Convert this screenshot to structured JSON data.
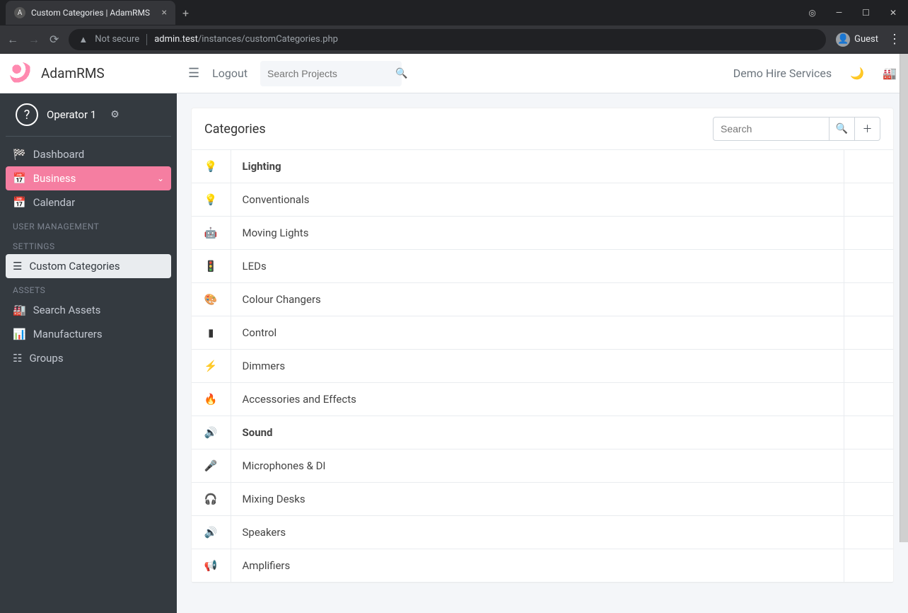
{
  "browser": {
    "tab_title": "Custom Categories | AdamRMS",
    "not_secure": "Not secure",
    "url_host": "admin.test",
    "url_path": "/instances/customCategories.php",
    "guest_label": "Guest"
  },
  "brand": {
    "name": "AdamRMS"
  },
  "user": {
    "name": "Operator 1"
  },
  "topbar": {
    "logout": "Logout",
    "search_placeholder": "Search Projects",
    "instance_name": "Demo Hire Services"
  },
  "sidebar": {
    "items": [
      {
        "label": "Dashboard",
        "icon": "gauge-icon"
      },
      {
        "label": "Business",
        "icon": "calendar-icon",
        "expandable": true,
        "active": "pink"
      },
      {
        "label": "Calendar",
        "icon": "calendar-icon"
      }
    ],
    "section_user_mgmt": "USER MANAGEMENT",
    "section_settings": "SETTINGS",
    "settings_items": [
      {
        "label": "Custom Categories",
        "icon": "list-icon",
        "active": "white"
      }
    ],
    "section_assets": "ASSETS",
    "asset_items": [
      {
        "label": "Search Assets",
        "icon": "warehouse-icon"
      },
      {
        "label": "Manufacturers",
        "icon": "industry-icon"
      },
      {
        "label": "Groups",
        "icon": "layers-icon"
      }
    ]
  },
  "card": {
    "title": "Categories",
    "search_placeholder": "Search"
  },
  "categories": [
    {
      "label": "Lighting",
      "icon": "💡",
      "header": true
    },
    {
      "label": "Conventionals",
      "icon": "💡"
    },
    {
      "label": "Moving Lights",
      "icon": "🤖"
    },
    {
      "label": "LEDs",
      "icon": "🚦"
    },
    {
      "label": "Colour Changers",
      "icon": "🎨"
    },
    {
      "label": "Control",
      "icon": "▮"
    },
    {
      "label": "Dimmers",
      "icon": "⚡"
    },
    {
      "label": "Accessories and Effects",
      "icon": "🔥"
    },
    {
      "label": "Sound",
      "icon": "🔊",
      "header": true
    },
    {
      "label": "Microphones & DI",
      "icon": "🎤"
    },
    {
      "label": "Mixing Desks",
      "icon": "🎧"
    },
    {
      "label": "Speakers",
      "icon": "🔊"
    },
    {
      "label": "Amplifiers",
      "icon": "📢"
    }
  ]
}
